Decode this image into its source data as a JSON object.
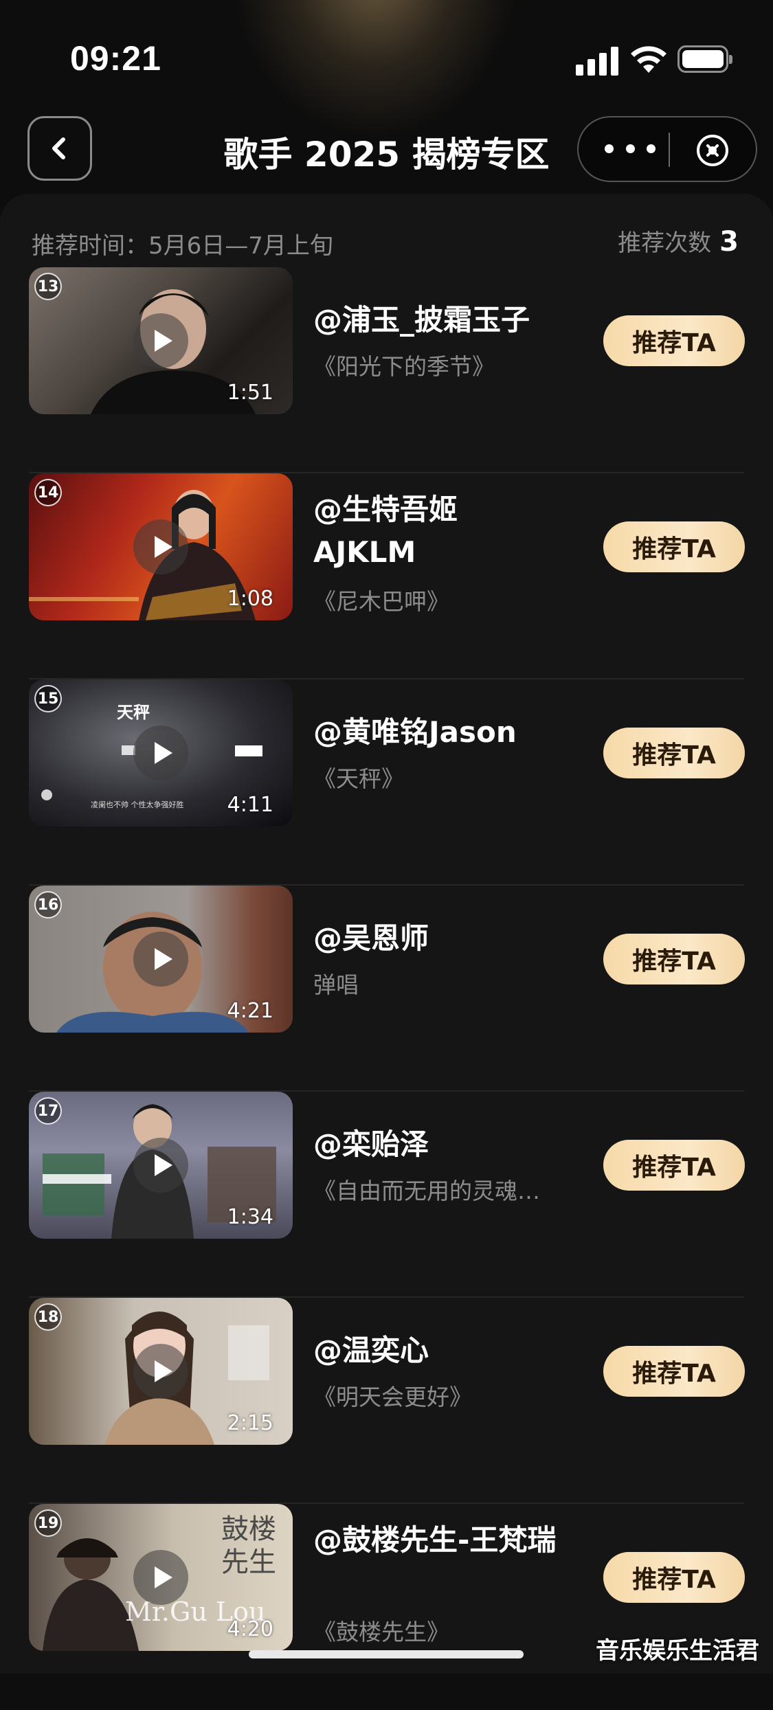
{
  "status": {
    "time": "09:21"
  },
  "nav": {
    "title": "歌手 2025 揭榜专区"
  },
  "meta": {
    "period": "推荐时间：5月6日—7月上旬",
    "count_label": "推荐次数",
    "count": "3"
  },
  "items": [
    {
      "rank": "13",
      "artist": "@浦玉_披霜玉子",
      "song": "《阳光下的季节》",
      "duration": "1:51",
      "button": "推荐TA"
    },
    {
      "rank": "14",
      "artist": "@生特吾姬AJKLM",
      "song": "《尼木巴呷》",
      "duration": "1:08",
      "button": "推荐TA"
    },
    {
      "rank": "15",
      "artist": "@黄唯铭Jason",
      "song": "《天秤》",
      "duration": "4:11",
      "button": "推荐TA"
    },
    {
      "rank": "16",
      "artist": "@吴恩师",
      "song": "弹唱",
      "duration": "4:21",
      "button": "推荐TA"
    },
    {
      "rank": "17",
      "artist": "@栾贻泽",
      "song": "《自由而无用的灵魂…",
      "duration": "1:34",
      "button": "推荐TA"
    },
    {
      "rank": "18",
      "artist": "@温奕心",
      "song": "《明天会更好》",
      "duration": "2:15",
      "button": "推荐TA"
    },
    {
      "rank": "19",
      "artist": "@鼓楼先生-王梵瑞",
      "song": "《鼓楼先生》",
      "duration": "4:20",
      "button": "推荐TA"
    }
  ],
  "watermark": "音乐娱乐生活君",
  "icons": {
    "back": "chevron-left-icon",
    "more": "more-dots-icon",
    "close": "close-circle-icon",
    "play": "play-icon"
  }
}
